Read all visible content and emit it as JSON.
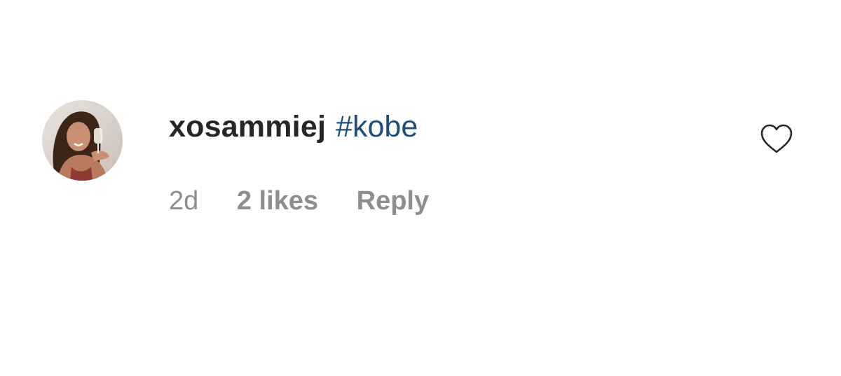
{
  "comment": {
    "username": "xosammiej",
    "text": "#kobe",
    "time": "2d",
    "likes": "2 likes",
    "reply_label": "Reply",
    "avatar_icon": "profile-photo",
    "like_icon": "heart-outline-icon"
  },
  "colors": {
    "username": "#262626",
    "hashtag": "#1f4d78",
    "meta": "#8e8e8e",
    "background": "#ffffff"
  }
}
